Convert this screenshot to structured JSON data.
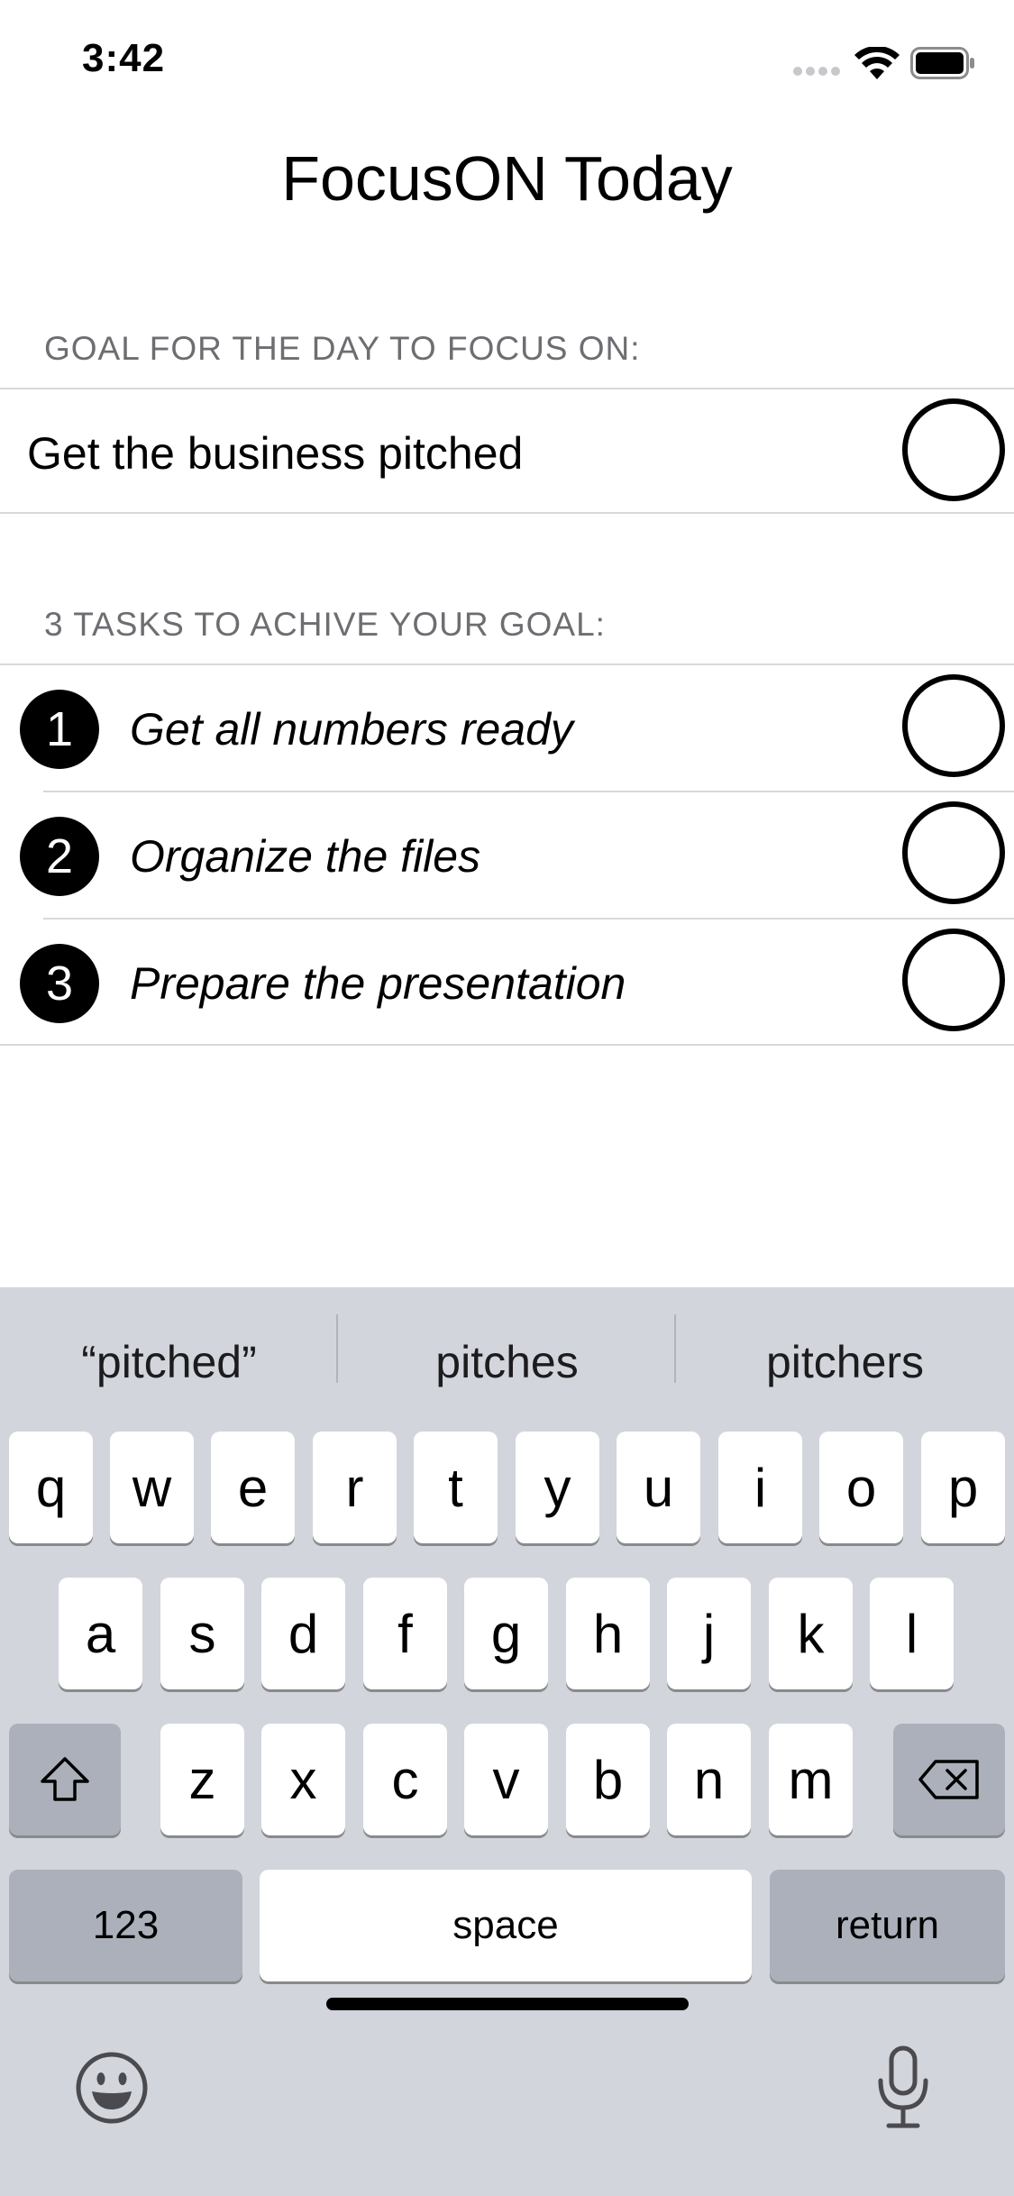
{
  "status_bar": {
    "time": "3:42",
    "wifi_icon": "wifi-icon",
    "battery_icon": "battery-icon"
  },
  "app": {
    "title": "FocusON Today"
  },
  "goal_section": {
    "header": "GOAL FOR THE DAY TO FOCUS ON:",
    "goal_text": "Get the business pitched",
    "completed": false
  },
  "tasks_section": {
    "header": "3 TASKS TO ACHIVE YOUR GOAL:",
    "tasks": [
      {
        "number": "1",
        "text": "Get all numbers ready",
        "completed": false
      },
      {
        "number": "2",
        "text": "Organize the files",
        "completed": false
      },
      {
        "number": "3",
        "text": "Prepare the presentation",
        "completed": false
      }
    ]
  },
  "keyboard": {
    "suggestions": [
      "“pitched”",
      "pitches",
      "pitchers"
    ],
    "row1": [
      "q",
      "w",
      "e",
      "r",
      "t",
      "y",
      "u",
      "i",
      "o",
      "p"
    ],
    "row2": [
      "a",
      "s",
      "d",
      "f",
      "g",
      "h",
      "j",
      "k",
      "l"
    ],
    "row3": [
      "z",
      "x",
      "c",
      "v",
      "b",
      "n",
      "m"
    ],
    "shift_icon": "shift-icon",
    "delete_icon": "delete-icon",
    "numbers_label": "123",
    "space_label": "space",
    "return_label": "return",
    "emoji_icon": "emoji-icon",
    "mic_icon": "microphone-icon",
    "colors": {
      "background": "#d2d5db",
      "key": "#ffffff",
      "function_key": "#abb0ba"
    }
  }
}
